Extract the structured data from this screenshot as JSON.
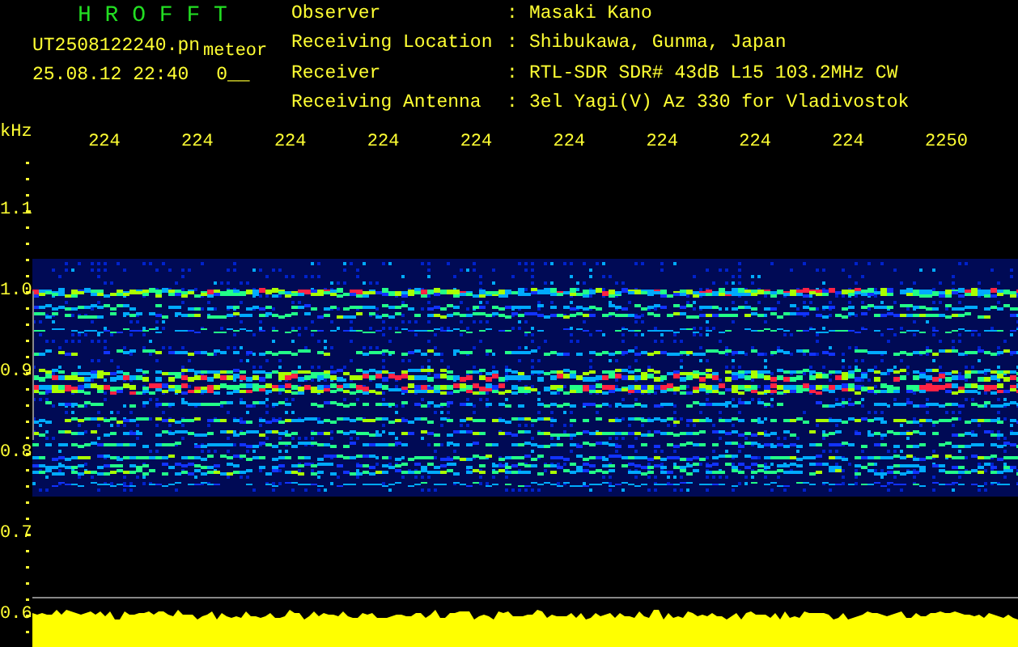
{
  "app_title": "H R O F F T",
  "file": {
    "name": "UT2508122240.pn",
    "type": "meteor",
    "timestamp": "25.08.12 22:40",
    "count": "0__"
  },
  "info": [
    {
      "label": "Observer",
      "separator": ":",
      "value": "Masaki Kano"
    },
    {
      "label": "Receiving Location",
      "separator": ":",
      "value": "Shibukawa, Gunma, Japan"
    },
    {
      "label": "Receiver",
      "separator": ":",
      "value": "RTL-SDR SDR# 43dB L15 103.2MHz CW"
    },
    {
      "label": "Receiving Antenna",
      "separator": ":",
      "value": "3el Yagi(V) Az 330 for Vladivostok"
    }
  ],
  "x_axis": {
    "labels": [
      "224",
      "224",
      "224",
      "224",
      "224",
      "224",
      "224",
      "224",
      "224",
      "2250"
    ]
  },
  "y_axis": {
    "unit": "kHz",
    "labels": [
      "1.1",
      "1.0",
      "0.9",
      "0.8",
      "0.7",
      "0.6"
    ]
  }
}
